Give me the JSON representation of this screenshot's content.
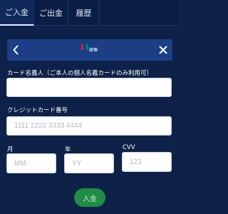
{
  "tabs": [
    {
      "label": "ご入金",
      "active": true
    },
    {
      "label": "ご出金",
      "active": false
    },
    {
      "label": "履歴",
      "active": false
    }
  ],
  "header": {
    "back_icon": "chevron-left-icon",
    "close_icon": "close-icon",
    "logo_text": "銀聯"
  },
  "form": {
    "cardholder_label": "カード名義人（ご本人の個人名義カードのみ利用可）",
    "cardholder_value": "",
    "cardholder_placeholder": "",
    "card_number_label": "クレジットカード番号",
    "card_number_placeholder": "1111 2222 3333 4444",
    "month_label": "月",
    "month_placeholder": "MM",
    "year_label": "年",
    "year_placeholder": "YY",
    "cvv_label": "CVV",
    "cvv_placeholder": "123",
    "submit_label": "入金"
  },
  "colors": {
    "background": "#0d2149",
    "header_bar": "#1b3e86",
    "submit_button": "#1e8d45"
  }
}
